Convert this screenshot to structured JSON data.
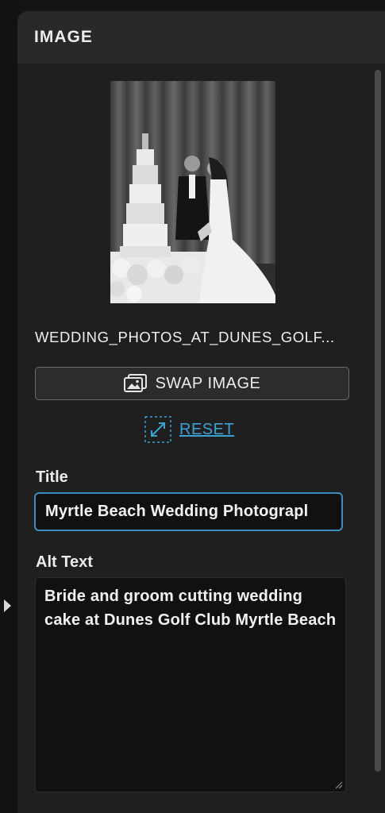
{
  "panel": {
    "title": "IMAGE"
  },
  "image": {
    "filename": "WEDDING_PHOTOS_AT_DUNES_GOLF...",
    "swap_label": "SWAP IMAGE",
    "reset_label": "RESET"
  },
  "fields": {
    "title_label": "Title",
    "title_value": "Myrtle Beach Wedding Photograpl",
    "alt_label": "Alt Text",
    "alt_value": "Bride and groom cutting wedding cake at Dunes Golf Club Myrtle Beach"
  },
  "colors": {
    "accent": "#3aa3d4",
    "focus_border": "#3c8fbd",
    "panel_bg": "#1f1f1f",
    "header_bg": "#292929"
  }
}
